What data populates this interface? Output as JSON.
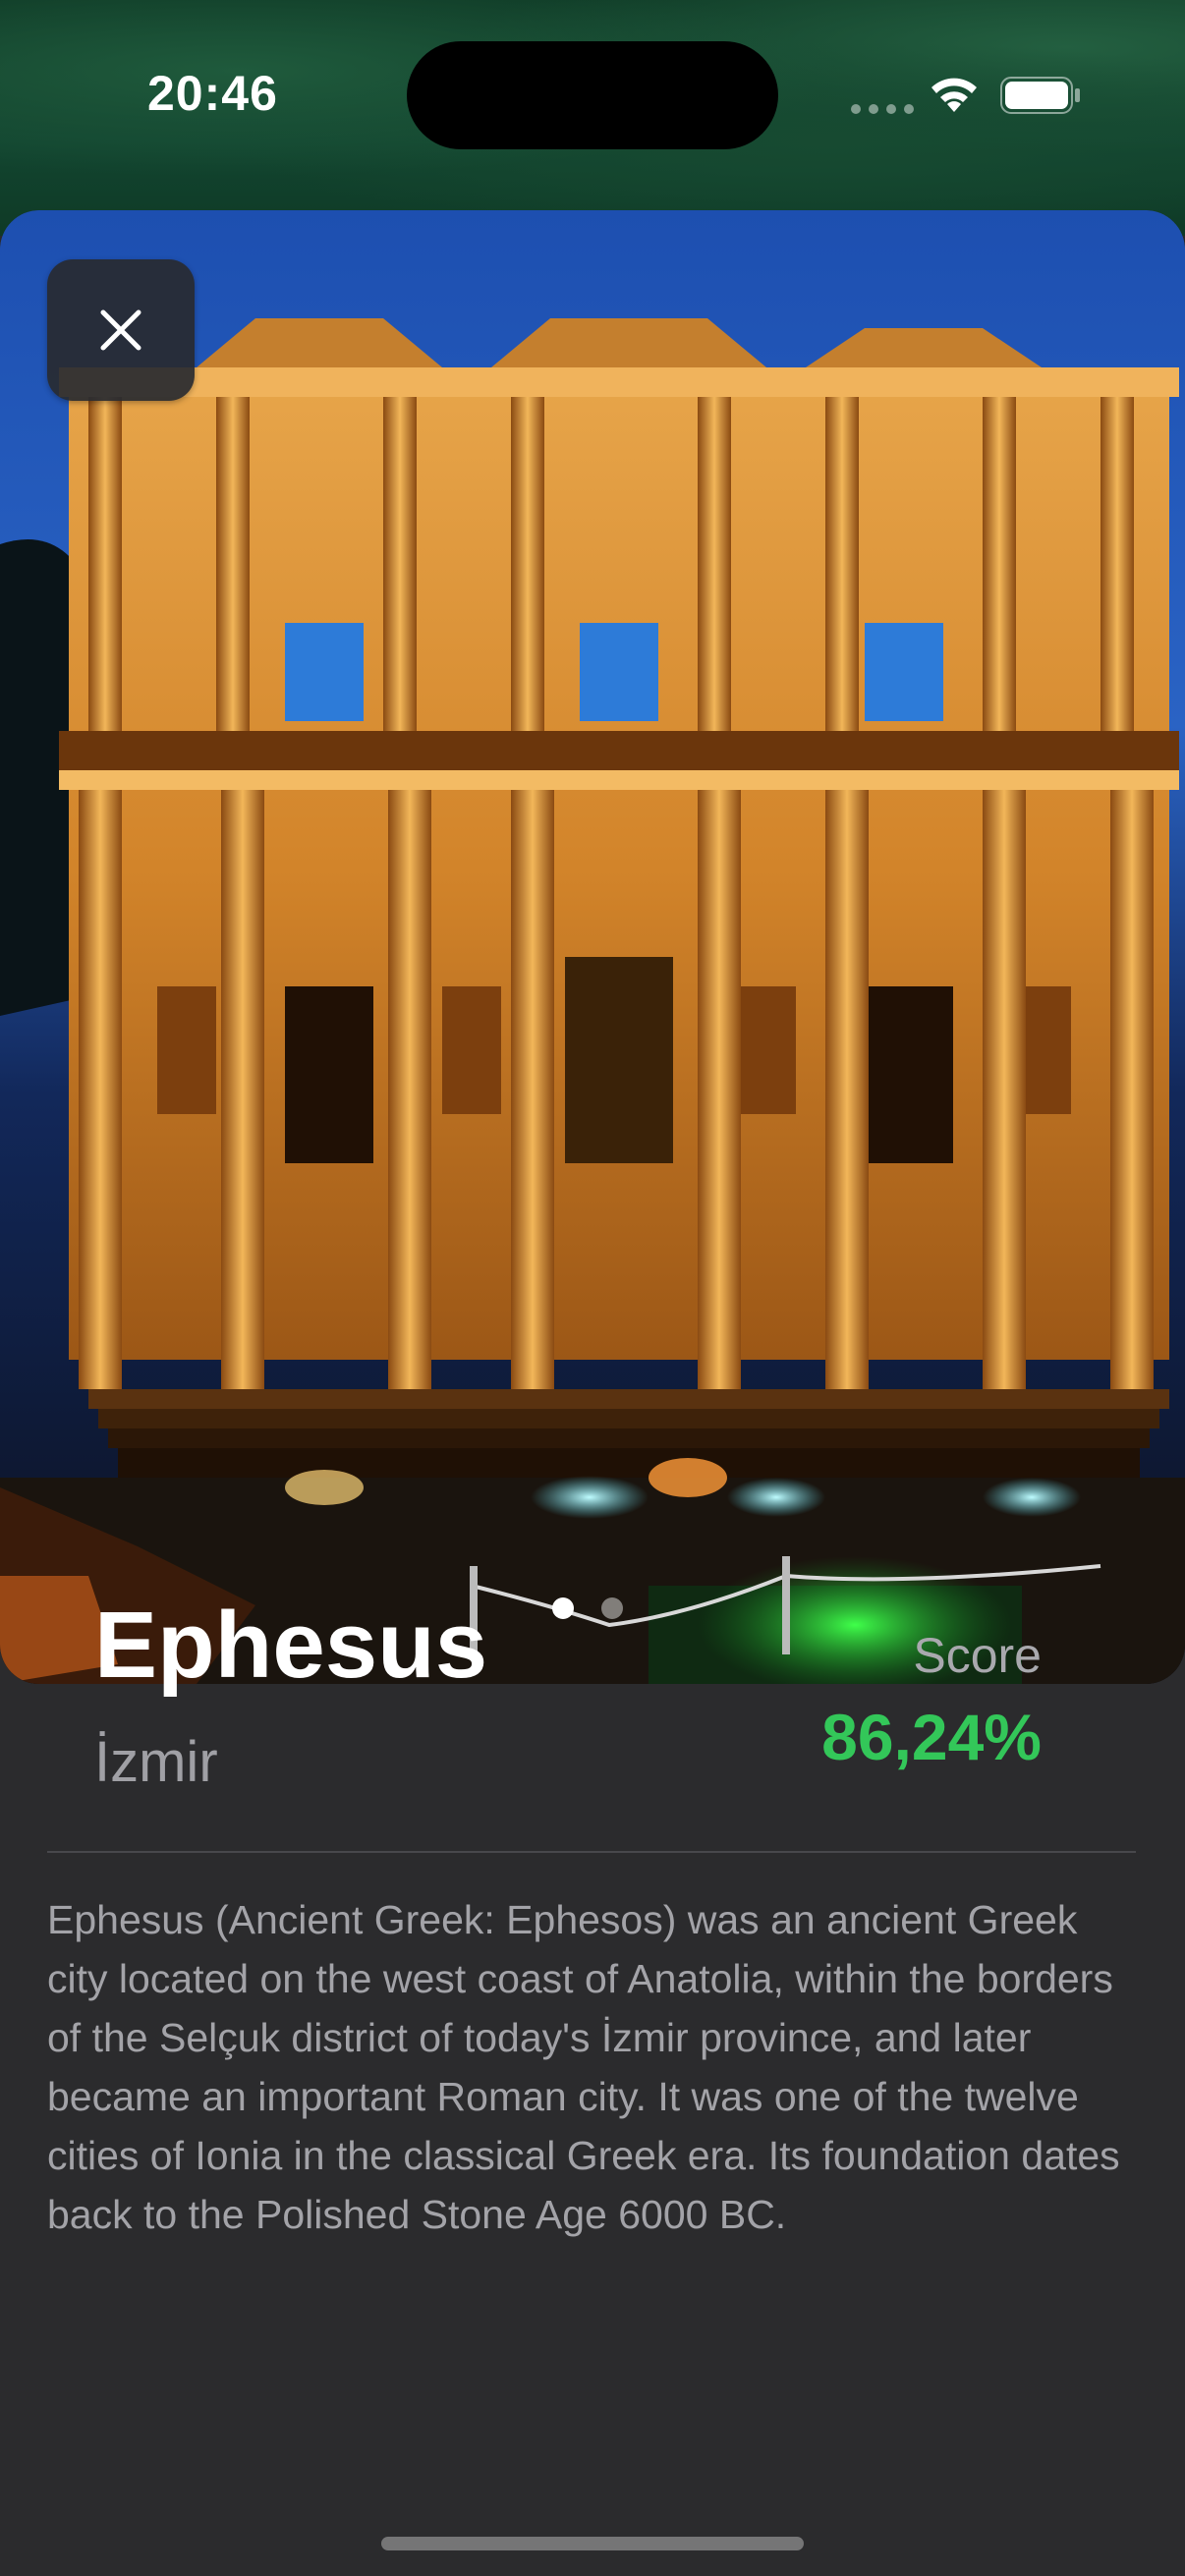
{
  "status_bar": {
    "time": "20:46"
  },
  "close_icon": "close-icon",
  "gallery": {
    "page_count": 2,
    "active_page": 1
  },
  "place": {
    "title": "Ephesus",
    "region": "İzmir",
    "score_label": "Score",
    "score_value": "86,24%",
    "description": "Ephesus (Ancient Greek: Ephesos) was an ancient Greek city located on the west coast of Anatolia, within the borders of the Selçuk district of today's İzmir province, and later became an important Roman city. It was one of the twelve cities of Ionia in the classical Greek era. Its foundation dates back to the Polished Stone Age 6000 BC."
  },
  "colors": {
    "score": "#33c759",
    "background": "#2b2b2d",
    "link": "#3b82f6"
  }
}
